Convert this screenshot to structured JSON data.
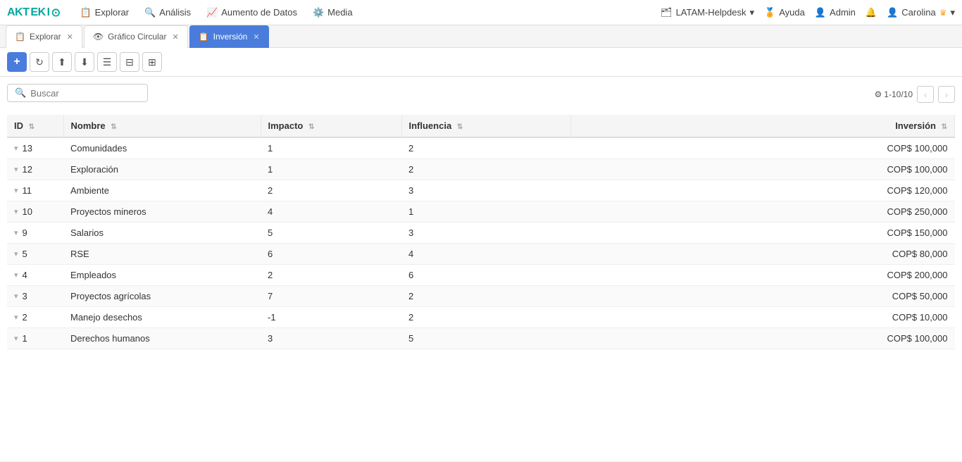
{
  "app": {
    "logo_text": "AKTEKIO",
    "logo_dot_color": "#00a99d"
  },
  "nav": {
    "items": [
      {
        "id": "explorar",
        "icon": "📋",
        "label": "Explorar"
      },
      {
        "id": "analisis",
        "icon": "🔍",
        "label": "Análisis"
      },
      {
        "id": "aumento_datos",
        "icon": "📈",
        "label": "Aumento de Datos"
      },
      {
        "id": "media",
        "icon": "⚙️",
        "label": "Media"
      }
    ],
    "right": {
      "helpdesk_label": "LATAM-Helpdesk",
      "ayuda_label": "Ayuda",
      "admin_label": "Admin",
      "user_label": "Carolina"
    }
  },
  "tabs": [
    {
      "id": "explorar",
      "label": "Explorar",
      "icon": "📋",
      "active": false,
      "closable": true
    },
    {
      "id": "grafico",
      "label": "Gráfico Circular",
      "icon": "👁",
      "active": false,
      "closable": true
    },
    {
      "id": "inversion",
      "label": "Inversión",
      "icon": "📋",
      "active": true,
      "closable": true
    }
  ],
  "toolbar": {
    "add_label": "+",
    "buttons": [
      "↻",
      "⬆",
      "⬇",
      "☰",
      "⊟",
      "⊞"
    ]
  },
  "search": {
    "placeholder": "Buscar"
  },
  "pagination": {
    "range": "1-10/10",
    "prev_disabled": true,
    "next_disabled": true
  },
  "table": {
    "columns": [
      {
        "id": "id",
        "label": "ID"
      },
      {
        "id": "nombre",
        "label": "Nombre"
      },
      {
        "id": "impacto",
        "label": "Impacto"
      },
      {
        "id": "influencia",
        "label": "Influencia"
      },
      {
        "id": "inversion",
        "label": "Inversión"
      }
    ],
    "rows": [
      {
        "id": 13,
        "nombre": "Comunidades",
        "impacto": 1,
        "influencia": 2,
        "inversion": "COP$ 100,000"
      },
      {
        "id": 12,
        "nombre": "Exploración",
        "impacto": 1,
        "influencia": 2,
        "inversion": "COP$ 100,000"
      },
      {
        "id": 11,
        "nombre": "Ambiente",
        "impacto": 2,
        "influencia": 3,
        "inversion": "COP$ 120,000"
      },
      {
        "id": 10,
        "nombre": "Proyectos mineros",
        "impacto": 4,
        "influencia": 1,
        "inversion": "COP$ 250,000"
      },
      {
        "id": 9,
        "nombre": "Salarios",
        "impacto": 5,
        "influencia": 3,
        "inversion": "COP$ 150,000"
      },
      {
        "id": 5,
        "nombre": "RSE",
        "impacto": 6,
        "influencia": 4,
        "inversion": "COP$ 80,000"
      },
      {
        "id": 4,
        "nombre": "Empleados",
        "impacto": 2,
        "influencia": 6,
        "inversion": "COP$ 200,000"
      },
      {
        "id": 3,
        "nombre": "Proyectos agrícolas",
        "impacto": 7,
        "influencia": 2,
        "inversion": "COP$ 50,000"
      },
      {
        "id": 2,
        "nombre": "Manejo desechos",
        "impacto": -1,
        "influencia": 2,
        "inversion": "COP$ 10,000"
      },
      {
        "id": 1,
        "nombre": "Derechos humanos",
        "impacto": 3,
        "influencia": 5,
        "inversion": "COP$ 100,000"
      }
    ]
  }
}
